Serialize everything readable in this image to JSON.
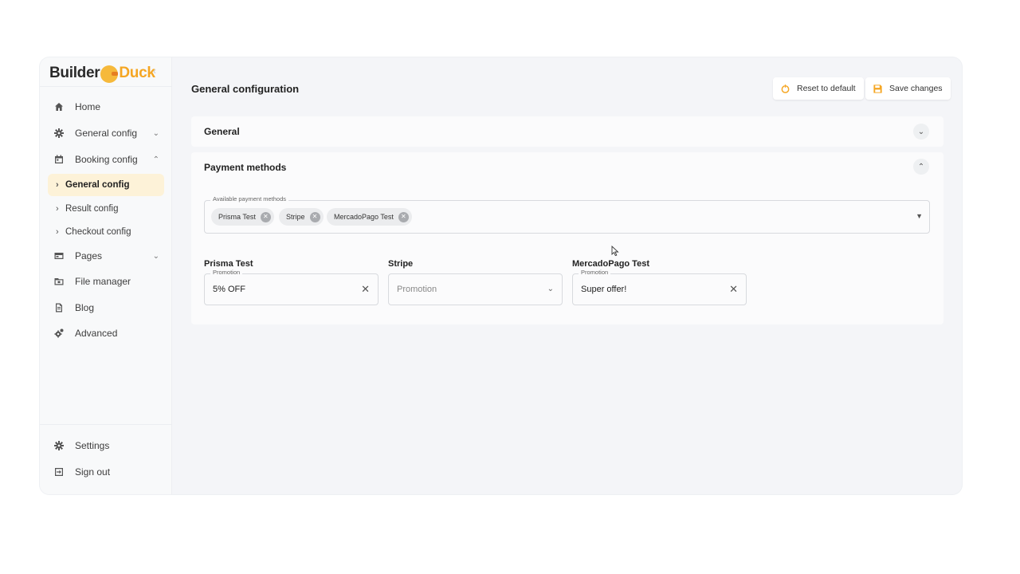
{
  "brand": {
    "part1": "Builder",
    "part2": "Duck"
  },
  "sidebar": {
    "collapse_icon": "chevron-left-icon",
    "items": [
      {
        "label": "Home",
        "icon": "home-icon"
      },
      {
        "label": "General config",
        "icon": "gear-icon",
        "chevron": "⌄"
      },
      {
        "label": "Booking config",
        "icon": "calendar-icon",
        "chevron": "⌃"
      },
      {
        "label": "Pages",
        "icon": "pages-icon",
        "chevron": "⌄"
      },
      {
        "label": "File manager",
        "icon": "folder-icon"
      },
      {
        "label": "Blog",
        "icon": "document-icon"
      },
      {
        "label": "Advanced",
        "icon": "gears-icon"
      }
    ],
    "subitems": [
      {
        "label": "General config",
        "active": true
      },
      {
        "label": "Result config",
        "active": false
      },
      {
        "label": "Checkout config",
        "active": false
      }
    ],
    "footer": [
      {
        "label": "Settings",
        "icon": "gear-icon"
      },
      {
        "label": "Sign out",
        "icon": "sign-out-icon"
      }
    ]
  },
  "header": {
    "title": "General configuration",
    "reset_label": "Reset to default",
    "save_label": "Save changes"
  },
  "panels": {
    "general": {
      "title": "General",
      "expanded": false
    },
    "payment": {
      "title": "Payment methods",
      "expanded": true,
      "available_label": "Available payment methods",
      "chips": [
        "Prisma Test",
        "Stripe",
        "MercadoPago Test"
      ],
      "methods": [
        {
          "name": "Prisma Test",
          "field_label": "Promotion",
          "value": "5% OFF",
          "placeholder": ""
        },
        {
          "name": "Stripe",
          "field_label": "",
          "value": "",
          "placeholder": "Promotion"
        },
        {
          "name": "MercadoPago Test",
          "field_label": "Promotion",
          "value": "Super offer!",
          "placeholder": ""
        }
      ]
    }
  },
  "colors": {
    "accent": "#f5a623",
    "active_bg": "#fdf2d8",
    "app_bg": "#f4f5f8"
  }
}
